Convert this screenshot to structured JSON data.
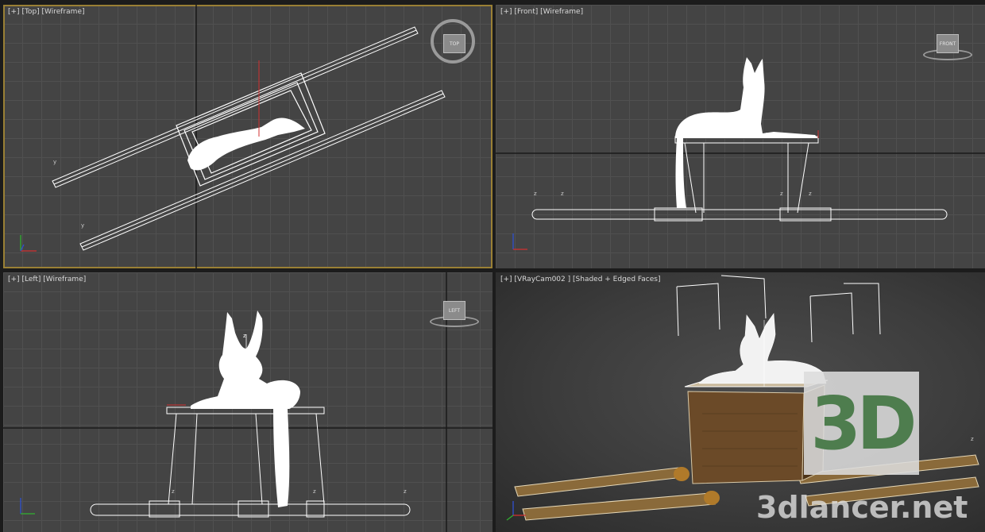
{
  "viewports": {
    "top": {
      "label": {
        "menu": "[+]",
        "view": "[Top]",
        "mode": "[Wireframe]"
      },
      "viewcube_label": "TOP"
    },
    "front": {
      "label": {
        "menu": "[+]",
        "view": "[Front]",
        "mode": "[Wireframe]"
      },
      "viewcube_label": "FRONT"
    },
    "left": {
      "label": {
        "menu": "[+]",
        "view": "[Left]",
        "mode": "[Wireframe]"
      },
      "viewcube_label": "LEFT"
    },
    "camera": {
      "label": {
        "menu": "[+]",
        "view": "[VRayCam002 ]",
        "mode": "[Shaded + Edged Faces]"
      }
    }
  },
  "watermark": {
    "logo_text": "3D",
    "site": "3dlancer.net"
  },
  "colors": {
    "viewport_bg": "#444444",
    "grid_line": "#505050",
    "active_border": "#9a8035",
    "wire_white": "#ffffff",
    "axis_red": "#d03030",
    "axis_green": "#30b030",
    "axis_blue": "#3050d0",
    "chest_brown": "#6b4a28",
    "pole_gold": "#b07a2a"
  }
}
